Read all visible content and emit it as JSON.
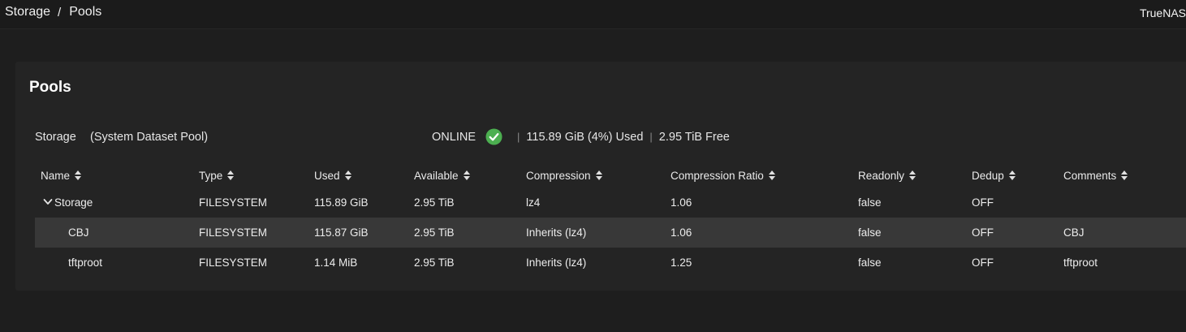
{
  "breadcrumb": {
    "root": "Storage",
    "separator": "/",
    "current": "Pools"
  },
  "brand": "TrueNAS",
  "card": {
    "title": "Pools"
  },
  "pool": {
    "name": "Storage",
    "description": "(System Dataset Pool)",
    "status": "ONLINE",
    "status_icon": "check-circle-icon",
    "status_color": "#4caf50",
    "used": "115.89 GiB (4%) Used",
    "free": "2.95 TiB Free",
    "divider": "|"
  },
  "table": {
    "columns": [
      "Name",
      "Type",
      "Used",
      "Available",
      "Compression",
      "Compression Ratio",
      "Readonly",
      "Dedup",
      "Comments"
    ],
    "rows": [
      {
        "name": "Storage",
        "type": "FILESYSTEM",
        "used": "115.89 GiB",
        "available": "2.95 TiB",
        "compression": "lz4",
        "ratio": "1.06",
        "readonly": "false",
        "dedup": "OFF",
        "comments": "",
        "expand_icon": "chevron-down-icon"
      },
      {
        "name": "CBJ",
        "type": "FILESYSTEM",
        "used": "115.87 GiB",
        "available": "2.95 TiB",
        "compression": "Inherits (lz4)",
        "ratio": "1.06",
        "readonly": "false",
        "dedup": "OFF",
        "comments": "CBJ"
      },
      {
        "name": "tftproot",
        "type": "FILESYSTEM",
        "used": "1.14 MiB",
        "available": "2.95 TiB",
        "compression": "Inherits (lz4)",
        "ratio": "1.25",
        "readonly": "false",
        "dedup": "OFF",
        "comments": "tftproot"
      }
    ]
  }
}
